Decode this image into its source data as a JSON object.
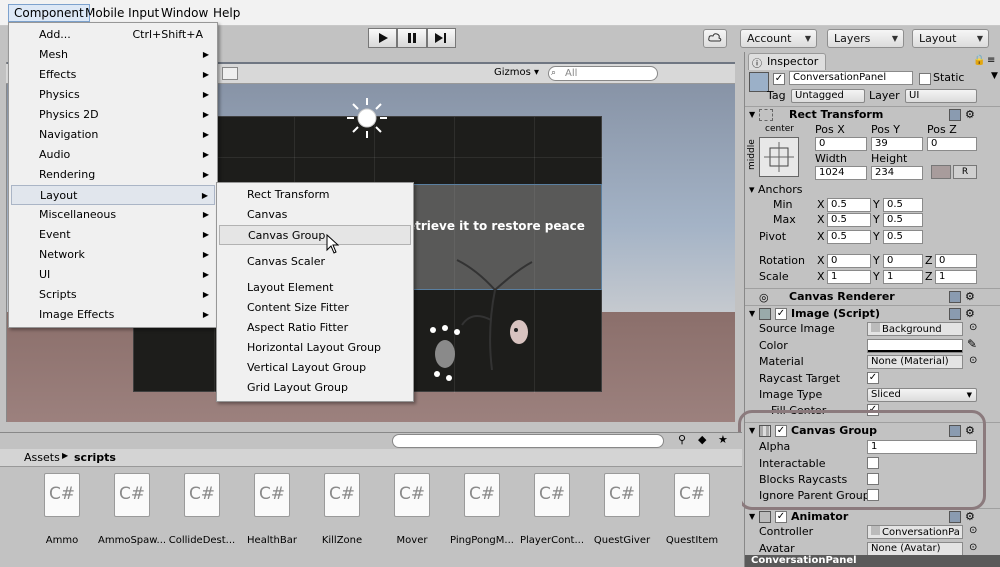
{
  "menubar": {
    "items": [
      "Component",
      "Mobile Input",
      "Window",
      "Help"
    ]
  },
  "toolbar": {
    "account": "Account",
    "layers": "Layers",
    "layout": "Layout"
  },
  "scene": {
    "gizmos": "Gizmos",
    "search_placeholder": "All",
    "overlay_text": "etrieve it to restore peace"
  },
  "component_menu": {
    "items": [
      {
        "label": "Add...",
        "shortcut": "Ctrl+Shift+A"
      },
      {
        "label": "Mesh"
      },
      {
        "label": "Effects"
      },
      {
        "label": "Physics"
      },
      {
        "label": "Physics 2D"
      },
      {
        "label": "Navigation"
      },
      {
        "label": "Audio"
      },
      {
        "label": "Rendering"
      },
      {
        "label": "Layout"
      },
      {
        "label": "Miscellaneous"
      },
      {
        "label": "Event"
      },
      {
        "label": "Network"
      },
      {
        "label": "UI"
      },
      {
        "label": "Scripts"
      },
      {
        "label": "Image Effects"
      }
    ],
    "highlighted": "Layout"
  },
  "layout_submenu": {
    "items": [
      "Rect Transform",
      "Canvas",
      "Canvas Group",
      "Canvas Scaler",
      "Layout Element",
      "Content Size Fitter",
      "Aspect Ratio Fitter",
      "Horizontal Layout Group",
      "Vertical Layout Group",
      "Grid Layout Group"
    ],
    "highlighted": "Canvas Group"
  },
  "inspector": {
    "tab": "Inspector",
    "object_name": "ConversationPanel",
    "static_label": "Static",
    "tag_label": "Tag",
    "tag_value": "Untagged",
    "layer_label": "Layer",
    "layer_value": "UI",
    "rect_transform": {
      "title": "Rect Transform",
      "anchor_h": "center",
      "anchor_v": "middle",
      "pos_x_label": "Pos X",
      "pos_y_label": "Pos Y",
      "pos_z_label": "Pos Z",
      "pos_x": "0",
      "pos_y": "39",
      "pos_z": "0",
      "width_label": "Width",
      "height_label": "Height",
      "width": "1024",
      "height": "234",
      "anchors_label": "Anchors",
      "min_label": "Min",
      "max_label": "Max",
      "pivot_label": "Pivot",
      "min_x": "0.5",
      "min_y": "0.5",
      "max_x": "0.5",
      "max_y": "0.5",
      "pivot_x": "0.5",
      "pivot_y": "0.5",
      "rotation_label": "Rotation",
      "scale_label": "Scale",
      "rot_x": "0",
      "rot_y": "0",
      "rot_z": "0",
      "scale_x": "1",
      "scale_y": "1",
      "scale_z": "1",
      "x": "X",
      "y": "Y",
      "z": "Z",
      "r_label": "R"
    },
    "canvas_renderer": {
      "title": "Canvas Renderer"
    },
    "image": {
      "title": "Image (Script)",
      "source_image_label": "Source Image",
      "source_image": "Background",
      "color_label": "Color",
      "material_label": "Material",
      "material": "None (Material)",
      "raycast_label": "Raycast Target",
      "image_type_label": "Image Type",
      "image_type": "Sliced",
      "fill_center_label": "Fill Center"
    },
    "canvas_group": {
      "title": "Canvas Group",
      "alpha_label": "Alpha",
      "alpha": "1",
      "interactable_label": "Interactable",
      "blocks_label": "Blocks Raycasts",
      "ignore_label": "Ignore Parent Group"
    },
    "animator": {
      "title": "Animator",
      "controller_label": "Controller",
      "controller": "ConversationPa",
      "avatar_label": "Avatar",
      "avatar": "None (Avatar)"
    },
    "footer": "ConversationPanel"
  },
  "project": {
    "breadcrumb_root": "Assets",
    "breadcrumb_folder": "scripts",
    "assets": [
      "Ammo",
      "AmmoSpaw...",
      "CollideDest...",
      "HealthBar",
      "KillZone",
      "Mover",
      "PingPongM...",
      "PlayerCont...",
      "QuestGiver",
      "QuestItem"
    ],
    "file_glyph": "C#"
  },
  "colors": {
    "menu_bg": "#f0f0f0",
    "highlight": "#e1e6ed",
    "panel_bg": "#c2c2c2",
    "oval": "#8b7a7d"
  }
}
